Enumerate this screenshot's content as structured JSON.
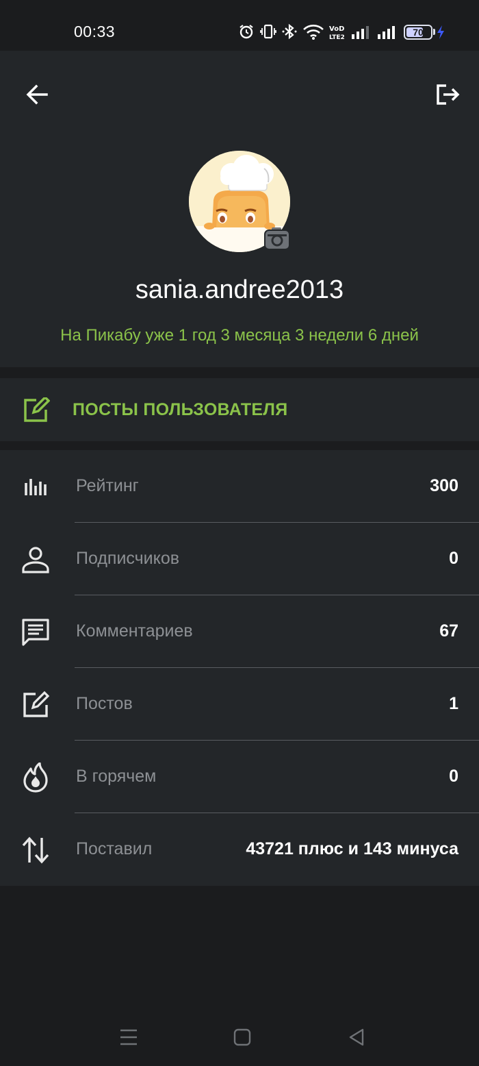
{
  "status_bar": {
    "time": "00:33",
    "battery": "70",
    "icons": [
      "alarm-icon",
      "vibrate-icon",
      "bluetooth-icon",
      "wifi-icon",
      "volte-icon",
      "signal-icon",
      "signal-icon",
      "battery-icon",
      "charging-icon"
    ]
  },
  "profile": {
    "username": "sania.andree2013",
    "member_since": "На Пикабу уже 1 год 3 месяца 3 недели 6 дней"
  },
  "posts_link": {
    "label": "ПОСТЫ ПОЛЬЗОВАТЕЛЯ"
  },
  "stats": [
    {
      "icon": "rating-icon",
      "label": "Рейтинг",
      "value": "300"
    },
    {
      "icon": "person-icon",
      "label": "Подписчиков",
      "value": "0"
    },
    {
      "icon": "comment-icon",
      "label": "Комментариев",
      "value": "67"
    },
    {
      "icon": "edit-icon",
      "label": "Постов",
      "value": "1"
    },
    {
      "icon": "flame-icon",
      "label": "В горячем",
      "value": "0"
    },
    {
      "icon": "sort-arrows-icon",
      "label": "Поставил",
      "value": "43721 плюс и 143 минуса"
    }
  ],
  "colors": {
    "accent_green": "#8bc34a",
    "panel": "#232629",
    "background": "#1b1c1e",
    "label_gray": "#8d9094"
  }
}
